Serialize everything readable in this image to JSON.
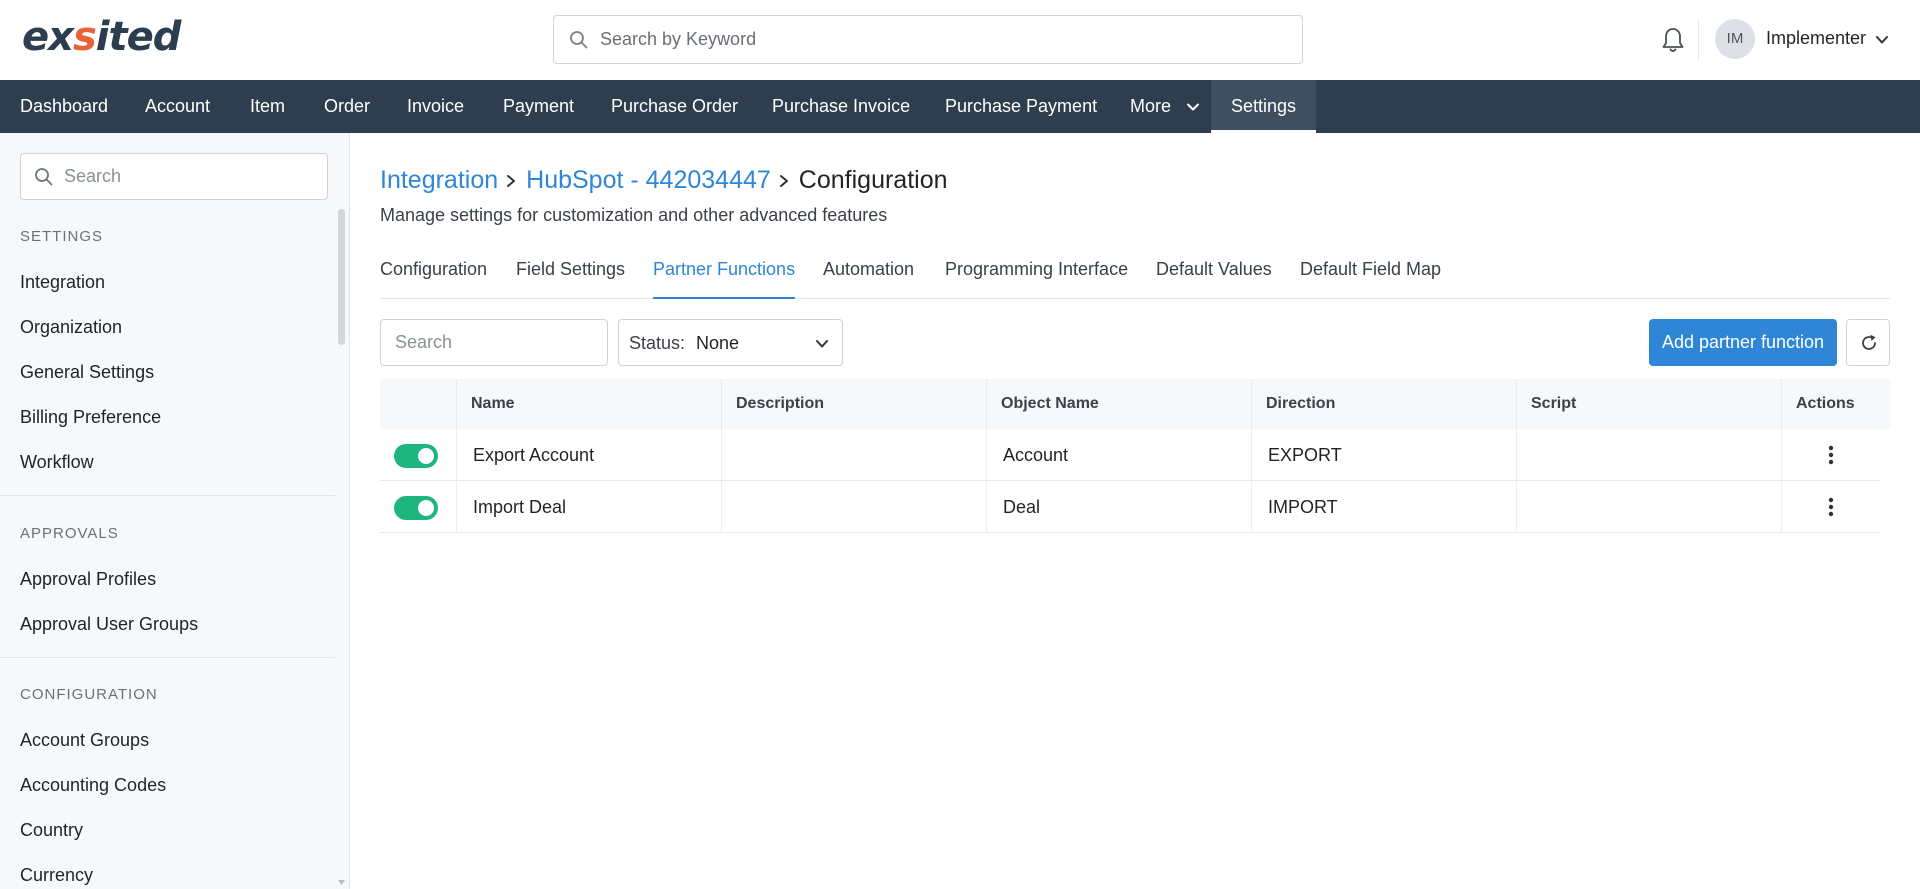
{
  "header": {
    "logo": {
      "part1": "ex",
      "part2": "s",
      "part3": "ited"
    },
    "search_placeholder": "Search by Keyword",
    "user": {
      "initials": "IM",
      "name": "Implementer"
    }
  },
  "nav": {
    "items": [
      "Dashboard",
      "Account",
      "Item",
      "Order",
      "Invoice",
      "Payment",
      "Purchase Order",
      "Purchase Invoice",
      "Purchase Payment",
      "More",
      "Settings"
    ],
    "active": "Settings"
  },
  "sidebar": {
    "search_placeholder": "Search",
    "sections": [
      {
        "title": "SETTINGS",
        "items": [
          "Integration",
          "Organization",
          "General Settings",
          "Billing Preference",
          "Workflow"
        ]
      },
      {
        "title": "APPROVALS",
        "items": [
          "Approval Profiles",
          "Approval User Groups"
        ]
      },
      {
        "title": "CONFIGURATION",
        "items": [
          "Account Groups",
          "Accounting Codes",
          "Country",
          "Currency"
        ]
      }
    ]
  },
  "main": {
    "breadcrumb": [
      "Integration",
      "HubSpot - 442034447",
      "Configuration"
    ],
    "subtitle": "Manage settings for customization and other advanced features",
    "tabs": [
      "Configuration",
      "Field Settings",
      "Partner Functions",
      "Automation",
      "Programming Interface",
      "Default Values",
      "Default Field Map"
    ],
    "active_tab": "Partner Functions",
    "filter": {
      "search_placeholder": "Search",
      "status_label": "Status:",
      "status_value": "None"
    },
    "add_button": "Add partner function",
    "table": {
      "columns": [
        "Name",
        "Description",
        "Object Name",
        "Direction",
        "Script",
        "Actions"
      ],
      "rows": [
        {
          "enabled": true,
          "name": "Export Account",
          "description": "",
          "object_name": "Account",
          "direction": "EXPORT",
          "script": ""
        },
        {
          "enabled": true,
          "name": "Import Deal",
          "description": "",
          "object_name": "Deal",
          "direction": "IMPORT",
          "script": ""
        }
      ]
    }
  },
  "colors": {
    "nav_bg": "#2f3e4e",
    "accent": "#2f86d6",
    "toggle_on": "#1fb57f",
    "logo_accent": "#e8623a"
  }
}
